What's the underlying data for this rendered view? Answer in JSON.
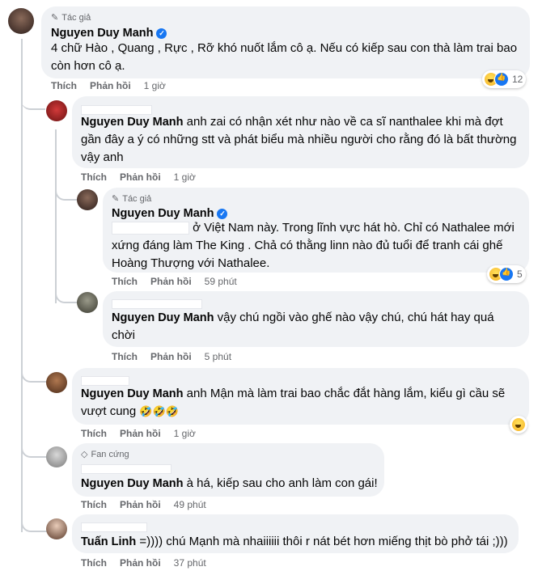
{
  "labels": {
    "like": "Thích",
    "reply": "Phản hồi",
    "author_badge": "Tác giả",
    "fan_badge": "Fan cứng"
  },
  "comments": [
    {
      "name": "Nguyen Duy Manh",
      "line1": "4 chữ Hào , Quang , Rực , Rỡ khó nuốt lắm cô ạ. Nếu có kiếp sau con thà làm trai bao",
      "line2": "còn hơn cô ạ.",
      "time": "1 giờ",
      "react_count": "12"
    },
    {
      "name": "Nguyen Duy Manh",
      "line1_tail": "anh zai có nhận xét như nào về ca sĩ nanthalee khi mà đợt",
      "line2": "gần đây a ý có những stt và phát biểu mà nhiều người cho rằng đó là bất thường",
      "line3": "vậy anh",
      "time": "1 giờ"
    },
    {
      "name": "Nguyen Duy Manh",
      "line1_tail": "ở Việt Nam này. Trong lĩnh vực hát hò. Chỉ có Nathalee mới",
      "line2": "xứng đáng làm The King . Chả có thằng linn nào đủ tuổi để tranh cái ghế",
      "line3": "Hoàng Thượng với Nathalee.",
      "time": "59 phút",
      "react_count": "5"
    },
    {
      "name": "Nguyen Duy Manh",
      "line1_tail": "vậy chú ngồi vào ghế nào vậy chú, chú hát hay quá",
      "line2": "chời",
      "time": "5 phút"
    },
    {
      "name": "Nguyen Duy Manh",
      "line1_tail": "anh Mận mà làm trai bao chắc đắt hàng lắm, kiểu gì cầu sẽ",
      "line2": "vượt cung",
      "emojis": "🤣🤣🤣",
      "time": "1 giờ"
    },
    {
      "name": "Nguyen Duy Manh",
      "line1_tail": "à há, kiếp sau cho anh làm con gái!",
      "time": "49 phút"
    },
    {
      "name": "Tuấn Linh",
      "line1_tail": "=)))) chú Mạnh mà nhaiiiiii thôi r nát bét hơn miếng thịt bò phở tái ;)))",
      "time": "37 phút"
    }
  ]
}
